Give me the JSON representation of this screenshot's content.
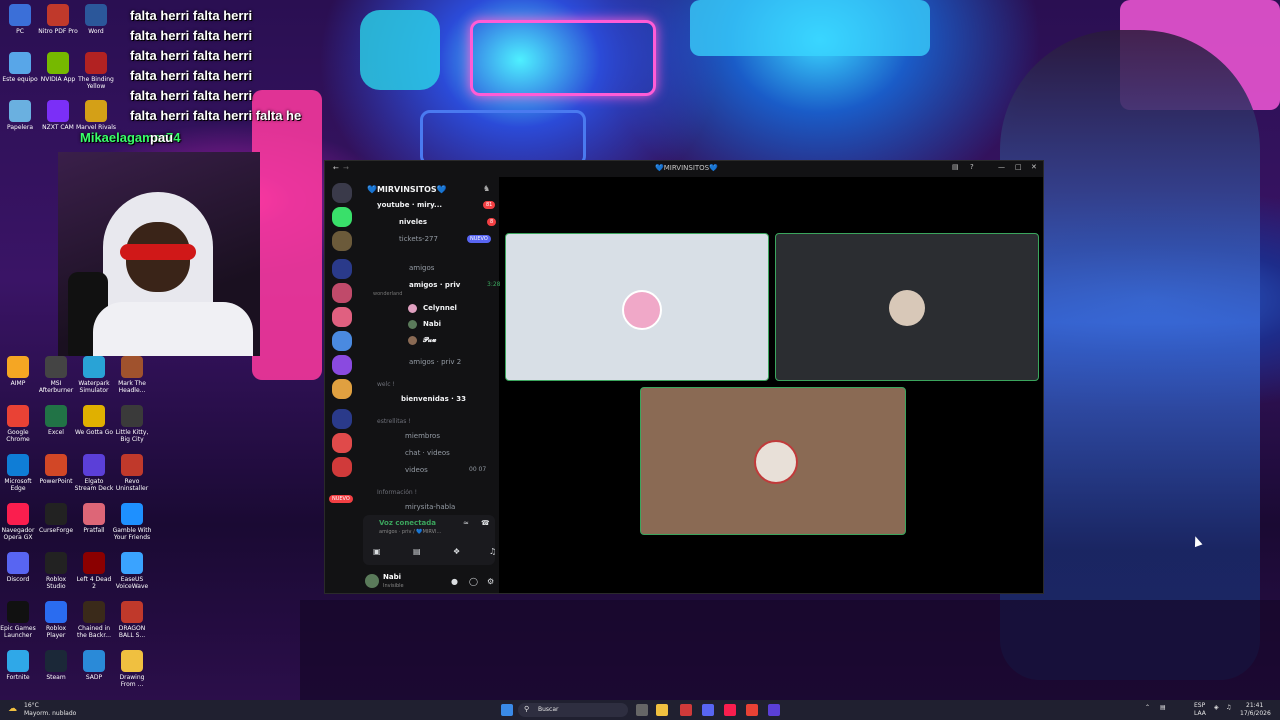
{
  "desktop": {
    "icons_left": [
      {
        "label": "PC",
        "color": "#3b6fd8"
      },
      {
        "label": "Nitro PDF Pro",
        "color": "#c0392b"
      },
      {
        "label": "Word",
        "color": "#2b579a"
      },
      {
        "label": "Este equipo",
        "color": "#58a6e8"
      },
      {
        "label": "NVIDIA App",
        "color": "#76b900"
      },
      {
        "label": "The Binding Yellow",
        "color": "#b22222"
      },
      {
        "label": "Papelera",
        "color": "#6ab0e0"
      },
      {
        "label": "NZXT CAM",
        "color": "#7b2ff7"
      },
      {
        "label": "Marvel Rivals",
        "color": "#d4a017"
      }
    ],
    "icons_grid": [
      {
        "label": "AIMP",
        "color": "#f5a623"
      },
      {
        "label": "MSI Afterburner",
        "color": "#444"
      },
      {
        "label": "Waterpark Simulator",
        "color": "#29a3d6"
      },
      {
        "label": "Mark The Headle...",
        "color": "#a0522d"
      },
      {
        "label": "Google Chrome",
        "color": "#e94235"
      },
      {
        "label": "Excel",
        "color": "#217346"
      },
      {
        "label": "We Gotta Go",
        "color": "#e0b000"
      },
      {
        "label": "Little Kitty, Big City",
        "color": "#3a3a3a"
      },
      {
        "label": "Microsoft Edge",
        "color": "#0f7dd6"
      },
      {
        "label": "PowerPoint",
        "color": "#d24726"
      },
      {
        "label": "Elgato Stream Deck",
        "color": "#5b3fd8"
      },
      {
        "label": "Revo Uninstaller",
        "color": "#c0392b"
      },
      {
        "label": "Navegador Opera GX",
        "color": "#fa1e4e"
      },
      {
        "label": "CurseForge",
        "color": "#222"
      },
      {
        "label": "Pratfall",
        "color": "#d67"
      },
      {
        "label": "Gamble With Your Friends",
        "color": "#1e90ff"
      },
      {
        "label": "Discord",
        "color": "#5865f2"
      },
      {
        "label": "Roblox Studio",
        "color": "#222"
      },
      {
        "label": "Left 4 Dead 2",
        "color": "#8b0000"
      },
      {
        "label": "EaseUS VoiceWave",
        "color": "#3aa3ff"
      },
      {
        "label": "Epic Games Launcher",
        "color": "#111"
      },
      {
        "label": "Roblox Player",
        "color": "#2a6cf0"
      },
      {
        "label": "Chained in the Backr...",
        "color": "#3a2a1a"
      },
      {
        "label": "DRAGON BALL S...",
        "color": "#c0392b"
      },
      {
        "label": "Fortnite",
        "color": "#2fa8e8"
      },
      {
        "label": "Steam",
        "color": "#1b2838"
      },
      {
        "label": "SADP",
        "color": "#2a8ad8"
      },
      {
        "label": "Drawing From ...",
        "color": "#f0c040"
      }
    ],
    "overlay_lines": [
      "falta herri falta herri",
      "falta herri falta herri",
      "falta herri falta herri",
      "falta herri falta herri",
      "falta herri falta herri",
      "falta herri falta herri falta he"
    ],
    "chat_user": "Mikaelagamer74",
    "chat_msg": "pau"
  },
  "discord": {
    "window_title": "💙MIRVINSITOS💙",
    "server_name": "💙MIRVINSITOS💙",
    "channels": {
      "youtube": "youtube · miry...",
      "youtube_badge": "81",
      "niveles": "niveles",
      "niveles_badge": "8",
      "tickets": "tickets-277",
      "tickets_badge": "NUEVO",
      "amigos": "amigos",
      "amigos_priv": "amigos · priv",
      "amigos_priv_time": "3:28",
      "amigos_priv_sub": "wonderland",
      "members": [
        "Celynnel",
        "Nabi",
        "𝓟𝓪𝓾"
      ],
      "amigos_priv2": "amigos · priv 2",
      "cat_welc": "welc !",
      "bienvenidas": "bienvenidas · 33",
      "cat_estrellitas": "estrellitas !",
      "miembros": "miembros",
      "chat_videos": "chat · videos",
      "videos": "videos",
      "videos_badge": "00 07",
      "cat_info": "Información !",
      "mirysita": "mirysita-habla"
    },
    "voice": {
      "status": "Voz conectada",
      "sub": "amigos · priv / 💙MIRVI..."
    },
    "user": {
      "name": "Nabi",
      "status": "Invisible"
    },
    "nuevo_label": "NUEVO"
  },
  "taskbar": {
    "weather_temp": "16°C",
    "weather_desc": "Mayorm. nublado",
    "search_placeholder": "Buscar",
    "lang1": "ESP",
    "lang2": "LAA",
    "time": "21:41",
    "date": "17/6/2026"
  }
}
